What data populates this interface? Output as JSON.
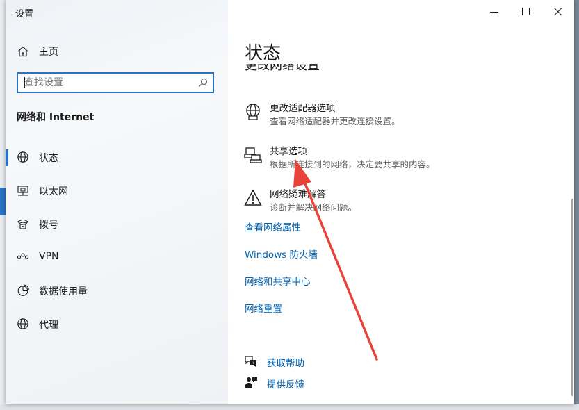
{
  "window": {
    "title": "设置",
    "controls": {
      "minimize": "minimize",
      "maximize": "maximize",
      "close": "close"
    }
  },
  "nav": {
    "home_label": "主页",
    "search": {
      "placeholder": "查找设置",
      "value": ""
    },
    "section_title": "网络和 Internet",
    "items": [
      {
        "label": "状态",
        "icon": "globe-icon",
        "active": true
      },
      {
        "label": "以太网",
        "icon": "ethernet-icon",
        "active": false
      },
      {
        "label": "拨号",
        "icon": "dialup-icon",
        "active": false
      },
      {
        "label": "VPN",
        "icon": "vpn-icon",
        "active": false
      },
      {
        "label": "数据使用量",
        "icon": "data-usage-icon",
        "active": false
      },
      {
        "label": "代理",
        "icon": "globe-icon",
        "active": false
      }
    ]
  },
  "main": {
    "page_title": "状态",
    "section_heading_clipped": "更改网络设置",
    "options": [
      {
        "title": "更改适配器选项",
        "desc": "查看网络适配器并更改连接设置。",
        "icon": "adapter-globe-icon"
      },
      {
        "title": "共享选项",
        "desc": "根据所连接到的网络，决定要共享的内容。",
        "icon": "sharing-icon"
      },
      {
        "title": "网络疑难解答",
        "desc": "诊断并解决网络问题。",
        "icon": "warning-icon"
      }
    ],
    "links": [
      {
        "label": "查看网络属性"
      },
      {
        "label": "Windows 防火墙"
      },
      {
        "label": "网络和共享中心"
      },
      {
        "label": "网络重置"
      }
    ],
    "help": [
      {
        "label": "获取帮助",
        "icon": "help-chat-icon"
      },
      {
        "label": "提供反馈",
        "icon": "feedback-icon"
      }
    ]
  },
  "colors": {
    "accent": "#2a72c6",
    "link": "#0063b1",
    "annotation_arrow": "#e8423a"
  }
}
